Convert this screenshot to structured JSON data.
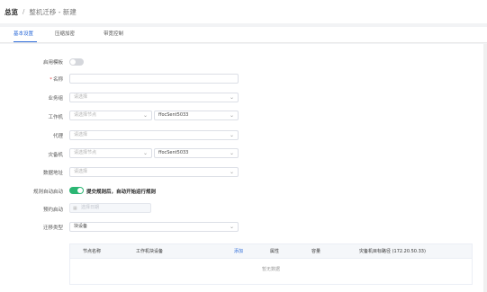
{
  "breadcrumb": {
    "root": "总览",
    "separator": "/",
    "current": "整机迁移 - 新建"
  },
  "tabs": [
    {
      "label": "基本设置",
      "active": true
    },
    {
      "label": "压缩加密",
      "active": false
    },
    {
      "label": "带宽控制",
      "active": false
    }
  ],
  "form": {
    "use_template": {
      "label": "启用模板",
      "enabled": false
    },
    "name": {
      "label": "名称",
      "required": true,
      "value": ""
    },
    "business_group": {
      "label": "业务组",
      "placeholder": "请选择"
    },
    "work_machine": {
      "label": "工作机",
      "node_placeholder": "请选择节点",
      "value": "ffocSent5033"
    },
    "proxy": {
      "label": "代理",
      "placeholder": "请选择"
    },
    "standby_machine": {
      "label": "灾备机",
      "node_placeholder": "请选择节点",
      "value": "ffocSent5033"
    },
    "data_address": {
      "label": "数据地址",
      "placeholder": "请选择"
    },
    "auto_start": {
      "label": "规则自动启动",
      "enabled": true,
      "text": "提交规则后，自动开始运行规则"
    },
    "scheduled_start": {
      "label": "预约启动",
      "placeholder": "选择日期"
    },
    "migration_type": {
      "label": "迁移类型",
      "value": "块设备"
    }
  },
  "table": {
    "columns": [
      "节点名称",
      "工作机块设备",
      "添加",
      "属性",
      "容量",
      "灾备机目标路径 (172.20.50.33)"
    ],
    "empty_text": "暂无数据"
  },
  "colors": {
    "accent": "#2d6bd9",
    "switch_on": "#2bb673",
    "required": "#e34d4d"
  }
}
